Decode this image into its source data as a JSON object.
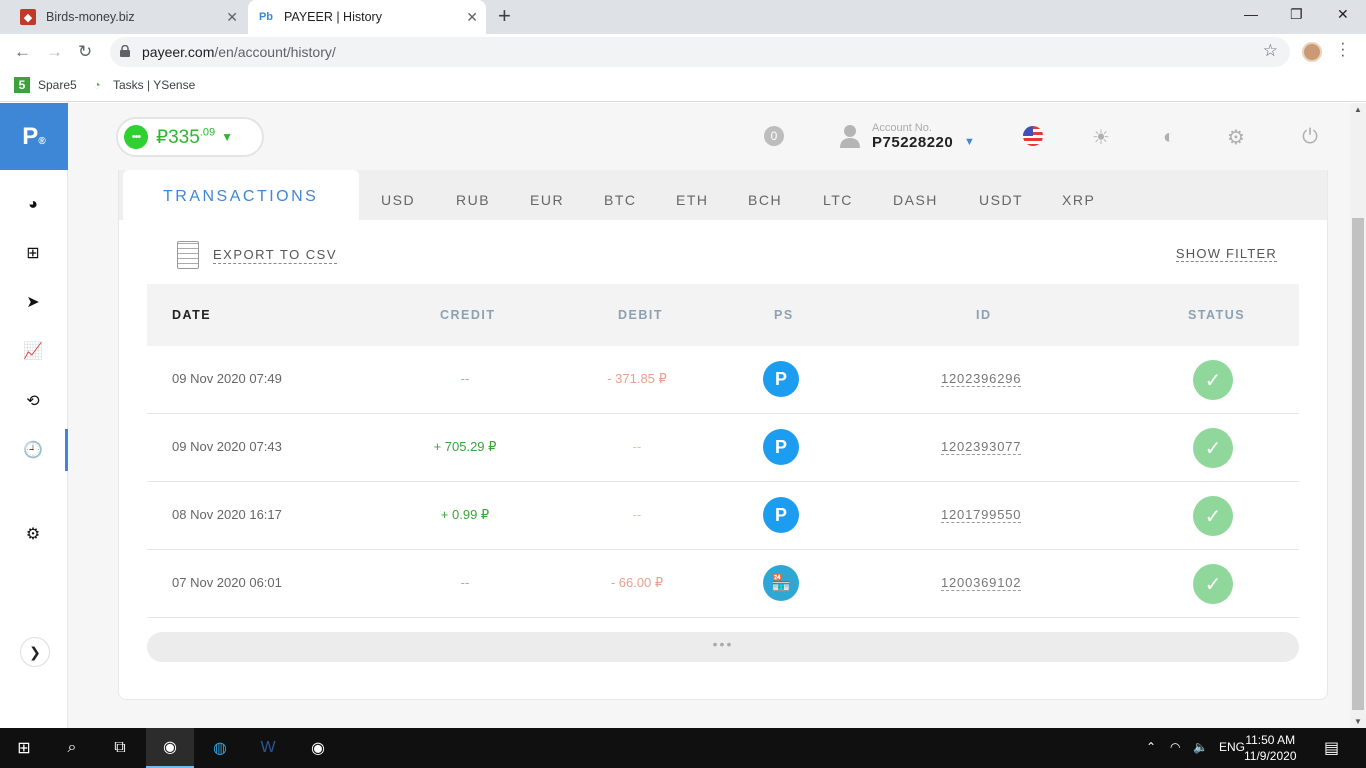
{
  "browser": {
    "tabs": [
      {
        "title": "Birds-money.biz",
        "active": false
      },
      {
        "title": "PAYEER | History",
        "active": true
      }
    ],
    "url_domain": "payeer.com",
    "url_path": "/en/account/history/",
    "bookmarks": [
      {
        "label": "Spare5",
        "icon": "spare5-icon"
      },
      {
        "label": "Tasks | YSense",
        "icon": "ysense-icon"
      }
    ]
  },
  "header": {
    "balance_main": "₽335",
    "balance_cents": ".09",
    "notifications": "0",
    "account_label": "Account No.",
    "account_number": "P75228220"
  },
  "tabs": {
    "main": "TRANSACTIONS",
    "currencies": [
      "USD",
      "RUB",
      "EUR",
      "BTC",
      "ETH",
      "BCH",
      "LTC",
      "DASH",
      "USDT",
      "XRP"
    ]
  },
  "actions": {
    "export": "EXPORT TO CSV",
    "filter": "SHOW FILTER",
    "more": "•••"
  },
  "table": {
    "headers": [
      "DATE",
      "CREDIT",
      "DEBIT",
      "PS",
      "ID",
      "STATUS"
    ],
    "rows": [
      {
        "date": "09 Nov 2020 07:49",
        "credit": "--",
        "debit": "- 371.85 ₽",
        "ps": "P",
        "ps_type": "payeer",
        "id": "1202396296",
        "status": "ok"
      },
      {
        "date": "09 Nov 2020 07:43",
        "credit": "+ 705.29 ₽",
        "debit": "--",
        "ps": "P",
        "ps_type": "payeer",
        "id": "1202393077",
        "status": "ok"
      },
      {
        "date": "08 Nov 2020 16:17",
        "credit": "+ 0.99 ₽",
        "debit": "--",
        "ps": "P",
        "ps_type": "payeer",
        "id": "1201799550",
        "status": "ok"
      },
      {
        "date": "07 Nov 2020 06:01",
        "credit": "--",
        "debit": "- 66.00 ₽",
        "ps": "",
        "ps_type": "shop",
        "id": "1200369102",
        "status": "ok"
      }
    ]
  },
  "taskbar": {
    "lang": "ENG",
    "time": "11:50 AM",
    "date": "11/9/2020"
  },
  "colors": {
    "brand": "#3e87d6",
    "credit": "#3aa43a",
    "debit": "#e9a08a",
    "status_ok": "#8fd79a"
  }
}
